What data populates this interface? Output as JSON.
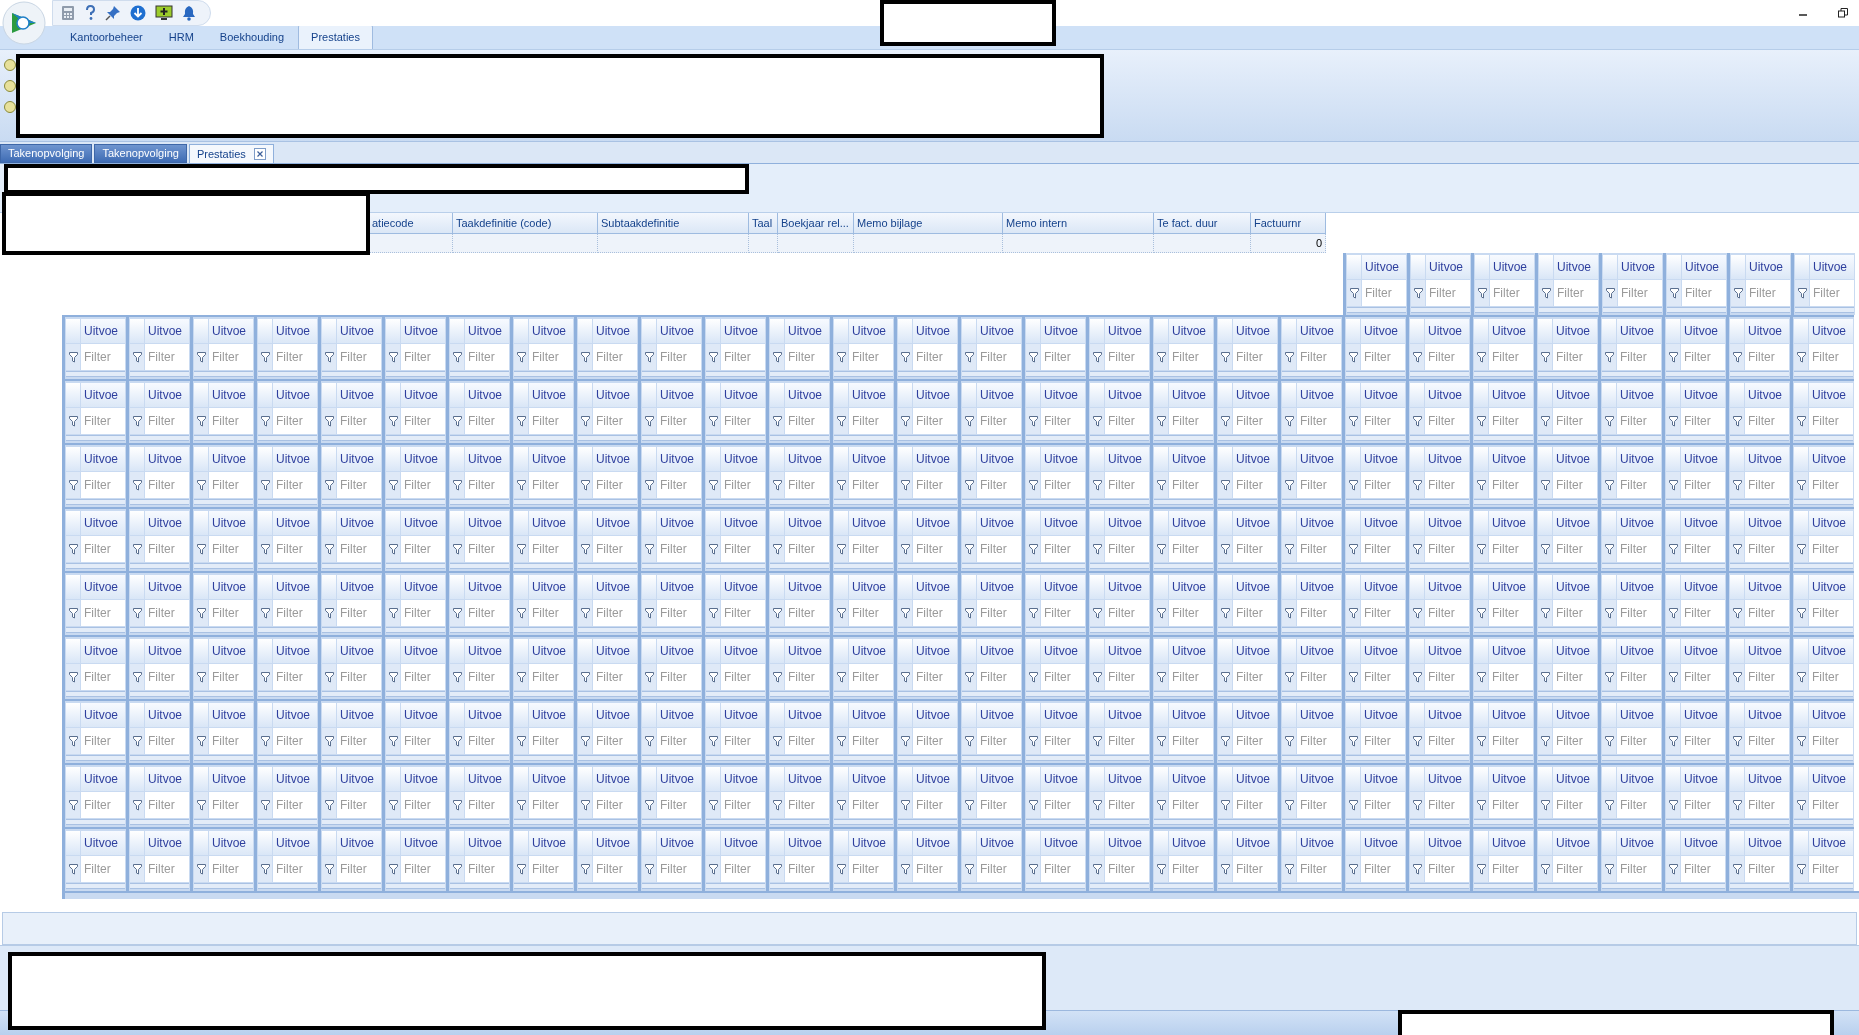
{
  "ribbon_tabs": [
    {
      "label": "Kantoorbeheer",
      "selected": false
    },
    {
      "label": "HRM",
      "selected": false
    },
    {
      "label": "Boekhouding",
      "selected": false
    },
    {
      "label": "Prestaties",
      "selected": true
    }
  ],
  "document_tabs": [
    {
      "label": "Takenopvolging",
      "selected": false,
      "closable": false
    },
    {
      "label": "Takenopvolging",
      "selected": false,
      "closable": false
    },
    {
      "label": "Prestaties",
      "selected": true,
      "closable": true
    }
  ],
  "grid": {
    "columns": [
      "atiecode",
      "Taakdefinitie (code)",
      "Subtaakdefinitie",
      "Taal",
      "Boekjaar rel...",
      "Memo bijlage",
      "Memo intern",
      "Te fact. duur",
      "Factuurnr"
    ],
    "rows": [
      {
        "factuurnr": "0"
      }
    ]
  },
  "filter_tiles": {
    "top_row": [
      {
        "header": "Uitvoe",
        "placeholder": "Filter"
      },
      {
        "header": "Uitvoe",
        "placeholder": "Filter"
      },
      {
        "header": "Uitvoe",
        "placeholder": "Filter"
      },
      {
        "header": "Uitvoe",
        "placeholder": "Filter"
      },
      {
        "header": "Uitvoe",
        "placeholder": "Filter"
      },
      {
        "header": "Uitvoe",
        "placeholder": "Filter"
      },
      {
        "header": "Uitvoe",
        "placeholder": "Filter"
      },
      {
        "header": "Uitvoe",
        "placeholder": "Filter"
      }
    ],
    "rows": [
      {
        "tiles": [
          {
            "header": "Uitvoe",
            "placeholder": "Filter"
          },
          {
            "header": "Uitvoe",
            "placeholder": "Filter"
          },
          {
            "header": "Uitvoe",
            "placeholder": "Filter"
          },
          {
            "header": "Uitvoe",
            "placeholder": "Filter"
          },
          {
            "header": "Uitvoe",
            "placeholder": "Filter"
          },
          {
            "header": "Uitvoe",
            "placeholder": "Filter"
          },
          {
            "header": "Uitvoe",
            "placeholder": "Filter"
          },
          {
            "header": "Uitvoe",
            "placeholder": "Filter"
          },
          {
            "header": "Uitvoe",
            "placeholder": "Filter"
          },
          {
            "header": "Uitvoe",
            "placeholder": "Filter"
          },
          {
            "header": "Uitvoe",
            "placeholder": "Filter"
          },
          {
            "header": "Uitvoe",
            "placeholder": "Filter"
          },
          {
            "header": "Uitvoe",
            "placeholder": "Filter"
          },
          {
            "header": "Uitvoe",
            "placeholder": "Filter"
          },
          {
            "header": "Uitvoe",
            "placeholder": "Filter"
          },
          {
            "header": "Uitvoe",
            "placeholder": "Filter"
          },
          {
            "header": "Uitvoe",
            "placeholder": "Filter"
          },
          {
            "header": "Uitvoe",
            "placeholder": "Filter"
          },
          {
            "header": "Uitvoe",
            "placeholder": "Filter"
          },
          {
            "header": "Uitvoe",
            "placeholder": "Filter"
          },
          {
            "header": "Uitvoe",
            "placeholder": "Filter"
          },
          {
            "header": "Uitvoe",
            "placeholder": "Filter"
          },
          {
            "header": "Uitvoe",
            "placeholder": "Filter"
          },
          {
            "header": "Uitvoe",
            "placeholder": "Filter"
          },
          {
            "header": "Uitvoe",
            "placeholder": "Filter"
          },
          {
            "header": "Uitvoe",
            "placeholder": "Filter"
          },
          {
            "header": "Uitvoe",
            "placeholder": "Filter"
          },
          {
            "header": "Uitvoe",
            "placeholder": "Filter"
          }
        ]
      },
      {
        "tiles": [
          {
            "header": "Uitvoe",
            "placeholder": "Filter"
          },
          {
            "header": "Uitvoe",
            "placeholder": "Filter"
          },
          {
            "header": "Uitvoe",
            "placeholder": "Filter"
          },
          {
            "header": "Uitvoe",
            "placeholder": "Filter"
          },
          {
            "header": "Uitvoe",
            "placeholder": "Filter"
          },
          {
            "header": "Uitvoe",
            "placeholder": "Filter"
          },
          {
            "header": "Uitvoe",
            "placeholder": "Filter"
          },
          {
            "header": "Uitvoe",
            "placeholder": "Filter"
          },
          {
            "header": "Uitvoe",
            "placeholder": "Filter"
          },
          {
            "header": "Uitvoe",
            "placeholder": "Filter"
          },
          {
            "header": "Uitvoe",
            "placeholder": "Filter"
          },
          {
            "header": "Uitvoe",
            "placeholder": "Filter"
          },
          {
            "header": "Uitvoe",
            "placeholder": "Filter"
          },
          {
            "header": "Uitvoe",
            "placeholder": "Filter"
          },
          {
            "header": "Uitvoe",
            "placeholder": "Filter"
          },
          {
            "header": "Uitvoe",
            "placeholder": "Filter"
          },
          {
            "header": "Uitvoe",
            "placeholder": "Filter"
          },
          {
            "header": "Uitvoe",
            "placeholder": "Filter"
          },
          {
            "header": "Uitvoe",
            "placeholder": "Filter"
          },
          {
            "header": "Uitvoe",
            "placeholder": "Filter"
          },
          {
            "header": "Uitvoe",
            "placeholder": "Filter"
          },
          {
            "header": "Uitvoe",
            "placeholder": "Filter"
          },
          {
            "header": "Uitvoe",
            "placeholder": "Filter"
          },
          {
            "header": "Uitvoe",
            "placeholder": "Filter"
          },
          {
            "header": "Uitvoe",
            "placeholder": "Filter"
          },
          {
            "header": "Uitvoe",
            "placeholder": "Filter"
          },
          {
            "header": "Uitvoe",
            "placeholder": "Filter"
          },
          {
            "header": "Uitvoe",
            "placeholder": "Filter"
          }
        ]
      },
      {
        "tiles": [
          {
            "header": "Uitvoe",
            "placeholder": "Filter"
          },
          {
            "header": "Uitvoe",
            "placeholder": "Filter"
          },
          {
            "header": "Uitvoe",
            "placeholder": "Filter"
          },
          {
            "header": "Uitvoe",
            "placeholder": "Filter"
          },
          {
            "header": "Uitvoe",
            "placeholder": "Filter"
          },
          {
            "header": "Uitvoe",
            "placeholder": "Filter"
          },
          {
            "header": "Uitvoe",
            "placeholder": "Filter"
          },
          {
            "header": "Uitvoe",
            "placeholder": "Filter"
          },
          {
            "header": "Uitvoe",
            "placeholder": "Filter"
          },
          {
            "header": "Uitvoe",
            "placeholder": "Filter"
          },
          {
            "header": "Uitvoe",
            "placeholder": "Filter"
          },
          {
            "header": "Uitvoe",
            "placeholder": "Filter"
          },
          {
            "header": "Uitvoe",
            "placeholder": "Filter"
          },
          {
            "header": "Uitvoe",
            "placeholder": "Filter"
          },
          {
            "header": "Uitvoe",
            "placeholder": "Filter"
          },
          {
            "header": "Uitvoe",
            "placeholder": "Filter"
          },
          {
            "header": "Uitvoe",
            "placeholder": "Filter"
          },
          {
            "header": "Uitvoe",
            "placeholder": "Filter"
          },
          {
            "header": "Uitvoe",
            "placeholder": "Filter"
          },
          {
            "header": "Uitvoe",
            "placeholder": "Filter"
          },
          {
            "header": "Uitvoe",
            "placeholder": "Filter"
          },
          {
            "header": "Uitvoe",
            "placeholder": "Filter"
          },
          {
            "header": "Uitvoe",
            "placeholder": "Filter"
          },
          {
            "header": "Uitvoe",
            "placeholder": "Filter"
          },
          {
            "header": "Uitvoe",
            "placeholder": "Filter"
          },
          {
            "header": "Uitvoe",
            "placeholder": "Filter"
          },
          {
            "header": "Uitvoe",
            "placeholder": "Filter"
          },
          {
            "header": "Uitvoe",
            "placeholder": "Filter"
          }
        ]
      },
      {
        "tiles": [
          {
            "header": "Uitvoe",
            "placeholder": "Filter"
          },
          {
            "header": "Uitvoe",
            "placeholder": "Filter"
          },
          {
            "header": "Uitvoe",
            "placeholder": "Filter"
          },
          {
            "header": "Uitvoe",
            "placeholder": "Filter"
          },
          {
            "header": "Uitvoe",
            "placeholder": "Filter"
          },
          {
            "header": "Uitvoe",
            "placeholder": "Filter"
          },
          {
            "header": "Uitvoe",
            "placeholder": "Filter"
          },
          {
            "header": "Uitvoe",
            "placeholder": "Filter"
          },
          {
            "header": "Uitvoe",
            "placeholder": "Filter"
          },
          {
            "header": "Uitvoe",
            "placeholder": "Filter"
          },
          {
            "header": "Uitvoe",
            "placeholder": "Filter"
          },
          {
            "header": "Uitvoe",
            "placeholder": "Filter"
          },
          {
            "header": "Uitvoe",
            "placeholder": "Filter"
          },
          {
            "header": "Uitvoe",
            "placeholder": "Filter"
          },
          {
            "header": "Uitvoe",
            "placeholder": "Filter"
          },
          {
            "header": "Uitvoe",
            "placeholder": "Filter"
          },
          {
            "header": "Uitvoe",
            "placeholder": "Filter"
          },
          {
            "header": "Uitvoe",
            "placeholder": "Filter"
          },
          {
            "header": "Uitvoe",
            "placeholder": "Filter"
          },
          {
            "header": "Uitvoe",
            "placeholder": "Filter"
          },
          {
            "header": "Uitvoe",
            "placeholder": "Filter"
          },
          {
            "header": "Uitvoe",
            "placeholder": "Filter"
          },
          {
            "header": "Uitvoe",
            "placeholder": "Filter"
          },
          {
            "header": "Uitvoe",
            "placeholder": "Filter"
          },
          {
            "header": "Uitvoe",
            "placeholder": "Filter"
          },
          {
            "header": "Uitvoe",
            "placeholder": "Filter"
          },
          {
            "header": "Uitvoe",
            "placeholder": "Filter"
          },
          {
            "header": "Uitvoe",
            "placeholder": "Filter"
          }
        ]
      },
      {
        "tiles": [
          {
            "header": "Uitvoe",
            "placeholder": "Filter"
          },
          {
            "header": "Uitvoe",
            "placeholder": "Filter"
          },
          {
            "header": "Uitvoe",
            "placeholder": "Filter"
          },
          {
            "header": "Uitvoe",
            "placeholder": "Filter"
          },
          {
            "header": "Uitvoe",
            "placeholder": "Filter"
          },
          {
            "header": "Uitvoe",
            "placeholder": "Filter"
          },
          {
            "header": "Uitvoe",
            "placeholder": "Filter"
          },
          {
            "header": "Uitvoe",
            "placeholder": "Filter"
          },
          {
            "header": "Uitvoe",
            "placeholder": "Filter"
          },
          {
            "header": "Uitvoe",
            "placeholder": "Filter"
          },
          {
            "header": "Uitvoe",
            "placeholder": "Filter"
          },
          {
            "header": "Uitvoe",
            "placeholder": "Filter"
          },
          {
            "header": "Uitvoe",
            "placeholder": "Filter"
          },
          {
            "header": "Uitvoe",
            "placeholder": "Filter"
          },
          {
            "header": "Uitvoe",
            "placeholder": "Filter"
          },
          {
            "header": "Uitvoe",
            "placeholder": "Filter"
          },
          {
            "header": "Uitvoe",
            "placeholder": "Filter"
          },
          {
            "header": "Uitvoe",
            "placeholder": "Filter"
          },
          {
            "header": "Uitvoe",
            "placeholder": "Filter"
          },
          {
            "header": "Uitvoe",
            "placeholder": "Filter"
          },
          {
            "header": "Uitvoe",
            "placeholder": "Filter"
          },
          {
            "header": "Uitvoe",
            "placeholder": "Filter"
          },
          {
            "header": "Uitvoe",
            "placeholder": "Filter"
          },
          {
            "header": "Uitvoe",
            "placeholder": "Filter"
          },
          {
            "header": "Uitvoe",
            "placeholder": "Filter"
          },
          {
            "header": "Uitvoe",
            "placeholder": "Filter"
          },
          {
            "header": "Uitvoe",
            "placeholder": "Filter"
          },
          {
            "header": "Uitvoe",
            "placeholder": "Filter"
          }
        ]
      },
      {
        "tiles": [
          {
            "header": "Uitvoe",
            "placeholder": "Filter"
          },
          {
            "header": "Uitvoe",
            "placeholder": "Filter"
          },
          {
            "header": "Uitvoe",
            "placeholder": "Filter"
          },
          {
            "header": "Uitvoe",
            "placeholder": "Filter"
          },
          {
            "header": "Uitvoe",
            "placeholder": "Filter"
          },
          {
            "header": "Uitvoe",
            "placeholder": "Filter"
          },
          {
            "header": "Uitvoe",
            "placeholder": "Filter"
          },
          {
            "header": "Uitvoe",
            "placeholder": "Filter"
          },
          {
            "header": "Uitvoe",
            "placeholder": "Filter"
          },
          {
            "header": "Uitvoe",
            "placeholder": "Filter"
          },
          {
            "header": "Uitvoe",
            "placeholder": "Filter"
          },
          {
            "header": "Uitvoe",
            "placeholder": "Filter"
          },
          {
            "header": "Uitvoe",
            "placeholder": "Filter"
          },
          {
            "header": "Uitvoe",
            "placeholder": "Filter"
          },
          {
            "header": "Uitvoe",
            "placeholder": "Filter"
          },
          {
            "header": "Uitvoe",
            "placeholder": "Filter"
          },
          {
            "header": "Uitvoe",
            "placeholder": "Filter"
          },
          {
            "header": "Uitvoe",
            "placeholder": "Filter"
          },
          {
            "header": "Uitvoe",
            "placeholder": "Filter"
          },
          {
            "header": "Uitvoe",
            "placeholder": "Filter"
          },
          {
            "header": "Uitvoe",
            "placeholder": "Filter"
          },
          {
            "header": "Uitvoe",
            "placeholder": "Filter"
          },
          {
            "header": "Uitvoe",
            "placeholder": "Filter"
          },
          {
            "header": "Uitvoe",
            "placeholder": "Filter"
          },
          {
            "header": "Uitvoe",
            "placeholder": "Filter"
          },
          {
            "header": "Uitvoe",
            "placeholder": "Filter"
          },
          {
            "header": "Uitvoe",
            "placeholder": "Filter"
          },
          {
            "header": "Uitvoe",
            "placeholder": "Filter"
          }
        ]
      },
      {
        "tiles": [
          {
            "header": "Uitvoe",
            "placeholder": "Filter"
          },
          {
            "header": "Uitvoe",
            "placeholder": "Filter"
          },
          {
            "header": "Uitvoe",
            "placeholder": "Filter"
          },
          {
            "header": "Uitvoe",
            "placeholder": "Filter"
          },
          {
            "header": "Uitvoe",
            "placeholder": "Filter"
          },
          {
            "header": "Uitvoe",
            "placeholder": "Filter"
          },
          {
            "header": "Uitvoe",
            "placeholder": "Filter"
          },
          {
            "header": "Uitvoe",
            "placeholder": "Filter"
          },
          {
            "header": "Uitvoe",
            "placeholder": "Filter"
          },
          {
            "header": "Uitvoe",
            "placeholder": "Filter"
          },
          {
            "header": "Uitvoe",
            "placeholder": "Filter"
          },
          {
            "header": "Uitvoe",
            "placeholder": "Filter"
          },
          {
            "header": "Uitvoe",
            "placeholder": "Filter"
          },
          {
            "header": "Uitvoe",
            "placeholder": "Filter"
          },
          {
            "header": "Uitvoe",
            "placeholder": "Filter"
          },
          {
            "header": "Uitvoe",
            "placeholder": "Filter"
          },
          {
            "header": "Uitvoe",
            "placeholder": "Filter"
          },
          {
            "header": "Uitvoe",
            "placeholder": "Filter"
          },
          {
            "header": "Uitvoe",
            "placeholder": "Filter"
          },
          {
            "header": "Uitvoe",
            "placeholder": "Filter"
          },
          {
            "header": "Uitvoe",
            "placeholder": "Filter"
          },
          {
            "header": "Uitvoe",
            "placeholder": "Filter"
          },
          {
            "header": "Uitvoe",
            "placeholder": "Filter"
          },
          {
            "header": "Uitvoe",
            "placeholder": "Filter"
          },
          {
            "header": "Uitvoe",
            "placeholder": "Filter"
          },
          {
            "header": "Uitvoe",
            "placeholder": "Filter"
          },
          {
            "header": "Uitvoe",
            "placeholder": "Filter"
          },
          {
            "header": "Uitvoe",
            "placeholder": "Filter"
          }
        ]
      },
      {
        "tiles": [
          {
            "header": "Uitvoe",
            "placeholder": "Filter"
          },
          {
            "header": "Uitvoe",
            "placeholder": "Filter"
          },
          {
            "header": "Uitvoe",
            "placeholder": "Filter"
          },
          {
            "header": "Uitvoe",
            "placeholder": "Filter"
          },
          {
            "header": "Uitvoe",
            "placeholder": "Filter"
          },
          {
            "header": "Uitvoe",
            "placeholder": "Filter"
          },
          {
            "header": "Uitvoe",
            "placeholder": "Filter"
          },
          {
            "header": "Uitvoe",
            "placeholder": "Filter"
          },
          {
            "header": "Uitvoe",
            "placeholder": "Filter"
          },
          {
            "header": "Uitvoe",
            "placeholder": "Filter"
          },
          {
            "header": "Uitvoe",
            "placeholder": "Filter"
          },
          {
            "header": "Uitvoe",
            "placeholder": "Filter"
          },
          {
            "header": "Uitvoe",
            "placeholder": "Filter"
          },
          {
            "header": "Uitvoe",
            "placeholder": "Filter"
          },
          {
            "header": "Uitvoe",
            "placeholder": "Filter"
          },
          {
            "header": "Uitvoe",
            "placeholder": "Filter"
          },
          {
            "header": "Uitvoe",
            "placeholder": "Filter"
          },
          {
            "header": "Uitvoe",
            "placeholder": "Filter"
          },
          {
            "header": "Uitvoe",
            "placeholder": "Filter"
          },
          {
            "header": "Uitvoe",
            "placeholder": "Filter"
          },
          {
            "header": "Uitvoe",
            "placeholder": "Filter"
          },
          {
            "header": "Uitvoe",
            "placeholder": "Filter"
          },
          {
            "header": "Uitvoe",
            "placeholder": "Filter"
          },
          {
            "header": "Uitvoe",
            "placeholder": "Filter"
          },
          {
            "header": "Uitvoe",
            "placeholder": "Filter"
          },
          {
            "header": "Uitvoe",
            "placeholder": "Filter"
          },
          {
            "header": "Uitvoe",
            "placeholder": "Filter"
          },
          {
            "header": "Uitvoe",
            "placeholder": "Filter"
          }
        ]
      },
      {
        "tiles": [
          {
            "header": "Uitvoe",
            "placeholder": "Filter"
          },
          {
            "header": "Uitvoe",
            "placeholder": "Filter"
          },
          {
            "header": "Uitvoe",
            "placeholder": "Filter"
          },
          {
            "header": "Uitvoe",
            "placeholder": "Filter"
          },
          {
            "header": "Uitvoe",
            "placeholder": "Filter"
          },
          {
            "header": "Uitvoe",
            "placeholder": "Filter"
          },
          {
            "header": "Uitvoe",
            "placeholder": "Filter"
          },
          {
            "header": "Uitvoe",
            "placeholder": "Filter"
          },
          {
            "header": "Uitvoe",
            "placeholder": "Filter"
          },
          {
            "header": "Uitvoe",
            "placeholder": "Filter"
          },
          {
            "header": "Uitvoe",
            "placeholder": "Filter"
          },
          {
            "header": "Uitvoe",
            "placeholder": "Filter"
          },
          {
            "header": "Uitvoe",
            "placeholder": "Filter"
          },
          {
            "header": "Uitvoe",
            "placeholder": "Filter"
          },
          {
            "header": "Uitvoe",
            "placeholder": "Filter"
          },
          {
            "header": "Uitvoe",
            "placeholder": "Filter"
          },
          {
            "header": "Uitvoe",
            "placeholder": "Filter"
          },
          {
            "header": "Uitvoe",
            "placeholder": "Filter"
          },
          {
            "header": "Uitvoe",
            "placeholder": "Filter"
          },
          {
            "header": "Uitvoe",
            "placeholder": "Filter"
          },
          {
            "header": "Uitvoe",
            "placeholder": "Filter"
          },
          {
            "header": "Uitvoe",
            "placeholder": "Filter"
          },
          {
            "header": "Uitvoe",
            "placeholder": "Filter"
          },
          {
            "header": "Uitvoe",
            "placeholder": "Filter"
          },
          {
            "header": "Uitvoe",
            "placeholder": "Filter"
          },
          {
            "header": "Uitvoe",
            "placeholder": "Filter"
          },
          {
            "header": "Uitvoe",
            "placeholder": "Filter"
          },
          {
            "header": "Uitvoe",
            "placeholder": "Filter"
          }
        ]
      }
    ]
  }
}
